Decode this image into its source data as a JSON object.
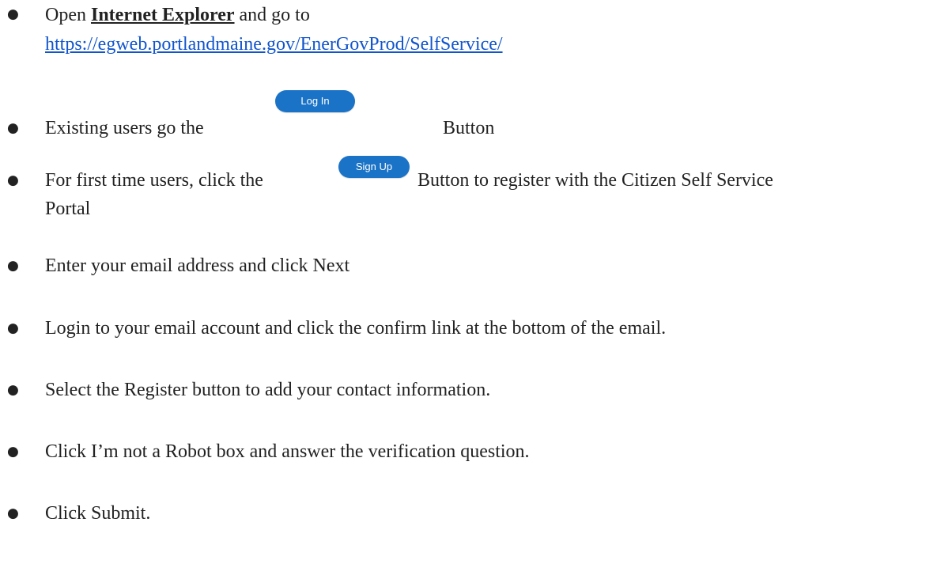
{
  "colors": {
    "text": "#222222",
    "link": "#1155cc",
    "button_blue": "#1b73c7"
  },
  "bullet_glyph": "●",
  "step1": {
    "prefix": "Open ",
    "browser": "Internet Explorer",
    "mid": " and go to",
    "url": "https://egweb.portlandmaine.gov/EnerGovProd/SelfService/"
  },
  "step2": {
    "prefix": "Existing users go the",
    "button_label": "Log In",
    "suffix": "Button"
  },
  "step3": {
    "prefix": "For first time users, click the",
    "button_label": "Sign Up",
    "suffix": "Button to register with the Citizen Self Service",
    "continuation": "Portal"
  },
  "step4": {
    "text": "Enter your email address and click Next"
  },
  "step5": {
    "text": "Login to your email account and click the confirm link at the bottom of the email."
  },
  "step6": {
    "text": "Select the Register button to add your contact information."
  },
  "step7": {
    "text": "Click I’m not a Robot box and answer the verification question."
  },
  "step8": {
    "text": "Click Submit."
  }
}
